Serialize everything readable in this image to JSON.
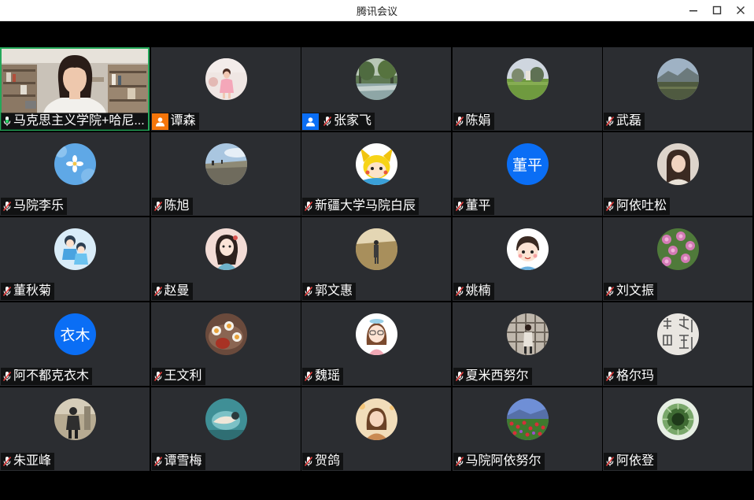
{
  "window": {
    "title": "腾讯会议",
    "controls": [
      "minimize-icon",
      "maximize-icon",
      "close-icon"
    ]
  },
  "colors": {
    "tile_bg": "#2b2d31",
    "active_border": "#25a85a",
    "text_avatar_bg": "#0a6ef5",
    "host_badge_bg": "#f5750a",
    "cohost_badge_bg": "#0a6ef5",
    "mic_muted": "#e23b3b"
  },
  "participants": [
    {
      "name": "马克思主义学院+哈尼...",
      "mic": "active",
      "video": true,
      "active": true
    },
    {
      "name": "谭森",
      "badge": "host",
      "avatar": "photo"
    },
    {
      "name": "张家飞",
      "badge": "cohost",
      "mic": "muted",
      "avatar": "photo"
    },
    {
      "name": "陈娟",
      "mic": "muted",
      "avatar": "photo"
    },
    {
      "name": "武磊",
      "mic": "muted",
      "avatar": "photo"
    },
    {
      "name": "马院李乐",
      "mic": "muted",
      "avatar": "photo"
    },
    {
      "name": "陈旭",
      "mic": "muted",
      "avatar": "photo"
    },
    {
      "name": "新疆大学马院白辰",
      "mic": "muted",
      "avatar": "photo"
    },
    {
      "name": "董平",
      "mic": "muted",
      "avatar_text": "董平"
    },
    {
      "name": "阿依吐松",
      "mic": "muted",
      "avatar": "photo"
    },
    {
      "name": "董秋菊",
      "mic": "muted",
      "avatar": "photo"
    },
    {
      "name": "赵曼",
      "mic": "muted",
      "avatar": "photo"
    },
    {
      "name": "郭文惠",
      "mic": "muted",
      "avatar": "photo"
    },
    {
      "name": "姚楠",
      "mic": "muted",
      "avatar": "photo"
    },
    {
      "name": "刘文振",
      "mic": "muted",
      "avatar": "photo"
    },
    {
      "name": "阿不都克衣木",
      "mic": "muted",
      "avatar_text": "衣木"
    },
    {
      "name": "王文利",
      "mic": "muted",
      "avatar": "photo"
    },
    {
      "name": "魏瑶",
      "mic": "muted",
      "avatar": "photo"
    },
    {
      "name": "夏米西努尔",
      "mic": "muted",
      "avatar": "photo"
    },
    {
      "name": "格尔玛",
      "mic": "muted",
      "avatar": "photo"
    },
    {
      "name": "朱亚峰",
      "mic": "muted",
      "avatar": "photo"
    },
    {
      "name": "谭雪梅",
      "mic": "muted",
      "avatar": "photo"
    },
    {
      "name": "贺鸽",
      "mic": "muted",
      "avatar": "photo"
    },
    {
      "name": "马院阿依努尔",
      "mic": "muted",
      "avatar": "photo"
    },
    {
      "name": "阿依登",
      "mic": "muted",
      "avatar": "photo"
    }
  ]
}
